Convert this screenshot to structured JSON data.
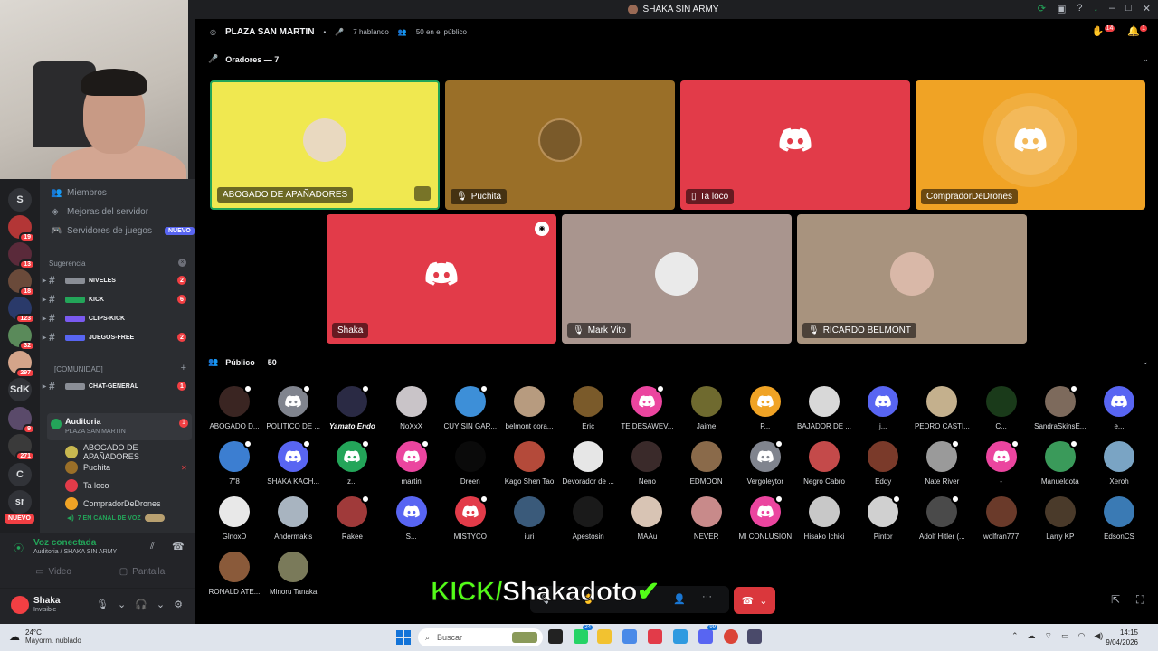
{
  "window": {
    "title": "SHAKA SIN ARMY"
  },
  "stage": {
    "channel": "PLAZA SAN MARTIN",
    "speaking": "7 hablando",
    "audience_count": "50 en el público",
    "hand_count": "14",
    "notif_count": "1",
    "speakers_header": "Oradores — 7",
    "audience_header": "Público — 50"
  },
  "speakers": [
    {
      "name": "ABOGADO DE APAÑADORES",
      "color": "#f0e850"
    },
    {
      "name": "Puchita",
      "color": "#9a6f28"
    },
    {
      "name": "Ta loco",
      "color": "#e23b49"
    },
    {
      "name": "CompradorDeDrones",
      "color": "#f0a325"
    },
    {
      "name": "Shaka",
      "color": "#e23b49"
    },
    {
      "name": "Mark Vito",
      "color": "#a9958e"
    },
    {
      "name": "RICARDO BELMONT",
      "color": "#a8937e"
    }
  ],
  "audience": [
    {
      "name": "ABOGADO D...",
      "color": "#3a2522",
      "icon": ""
    },
    {
      "name": "POLITICO DE ...",
      "color": "#80848e",
      "icon": "discord-icon"
    },
    {
      "name": "Yamato Endo",
      "color": "#2a2a44",
      "icon": ""
    },
    {
      "name": "NoXxX",
      "color": "#c9c4c8",
      "icon": ""
    },
    {
      "name": "CUY SIN GAR...",
      "color": "#3d8fd8",
      "icon": ""
    },
    {
      "name": "belmont cora...",
      "color": "#b79b7f",
      "icon": ""
    },
    {
      "name": "Eric",
      "color": "#7a5a2a",
      "icon": ""
    },
    {
      "name": "TE DESAWEV...",
      "color": "#eb459f",
      "icon": "discord-icon"
    },
    {
      "name": "Jaime",
      "color": "#6f6a2f",
      "icon": ""
    },
    {
      "name": "P...",
      "color": "#f0a325",
      "icon": "discord-icon"
    },
    {
      "name": "BAJADOR DE ...",
      "color": "#d8d8d8",
      "icon": ""
    },
    {
      "name": "j...",
      "color": "#5865f2",
      "icon": "discord-icon"
    },
    {
      "name": "PEDRO CASTI...",
      "color": "#c4b08d",
      "icon": ""
    },
    {
      "name": "C...",
      "color": "#1a3a1a",
      "icon": ""
    },
    {
      "name": "SandraSkinsE...",
      "color": "#7d6a5c",
      "icon": ""
    },
    {
      "name": "e...",
      "color": "#5865f2",
      "icon": "discord-icon"
    },
    {
      "name": "7\"8",
      "color": "#3c7ed1",
      "icon": ""
    },
    {
      "name": "SHAKA KACH...",
      "color": "#5865f2",
      "icon": "discord-icon"
    },
    {
      "name": "z...",
      "color": "#23a559",
      "icon": "discord-icon"
    },
    {
      "name": "martin",
      "color": "#eb459f",
      "icon": "discord-icon"
    },
    {
      "name": "Dreen",
      "color": "#0a0a0a",
      "icon": ""
    },
    {
      "name": "Kago Shen Tao",
      "color": "#b44a3a",
      "icon": ""
    },
    {
      "name": "Devorador de ...",
      "color": "#e6e6e6",
      "icon": ""
    },
    {
      "name": "Neno",
      "color": "#3a2a2a",
      "icon": ""
    },
    {
      "name": "EDMOON",
      "color": "#8a6a4a",
      "icon": ""
    },
    {
      "name": "Vergoleytor",
      "color": "#80848e",
      "icon": "discord-icon"
    },
    {
      "name": "Negro Cabro",
      "color": "#c44a4a",
      "icon": ""
    },
    {
      "name": "Eddy",
      "color": "#7a3a2a",
      "icon": ""
    },
    {
      "name": "Nate River",
      "color": "#9a9a9a",
      "icon": ""
    },
    {
      "name": "-",
      "color": "#eb459f",
      "icon": "discord-icon"
    },
    {
      "name": "Manueldota",
      "color": "#3a9a5a",
      "icon": ""
    },
    {
      "name": "Xeroh",
      "color": "#7aa4c4",
      "icon": ""
    },
    {
      "name": "GlnoxD",
      "color": "#e8e8e8",
      "icon": ""
    },
    {
      "name": "Andermakis",
      "color": "#a8b4c0",
      "icon": ""
    },
    {
      "name": "Rakee",
      "color": "#a03a3a",
      "icon": ""
    },
    {
      "name": "S...",
      "color": "#5865f2",
      "icon": "discord-icon"
    },
    {
      "name": "MISTYCO",
      "color": "#e23b49",
      "icon": "discord-icon"
    },
    {
      "name": "iuri",
      "color": "#3a5a7a",
      "icon": ""
    },
    {
      "name": "Apestosin",
      "color": "#1a1a1a",
      "icon": ""
    },
    {
      "name": "MAAu",
      "color": "#d8c4b4",
      "icon": ""
    },
    {
      "name": "NEVER",
      "color": "#c88a8a",
      "icon": ""
    },
    {
      "name": "MI CONLUSION",
      "color": "#eb459f",
      "icon": "discord-icon"
    },
    {
      "name": "Hisako Ichiki",
      "color": "#c8c8c8",
      "icon": ""
    },
    {
      "name": "Pintor",
      "color": "#d0d0d0",
      "icon": ""
    },
    {
      "name": "Adolf Hitler (...",
      "color": "#4a4a4a",
      "icon": ""
    },
    {
      "name": "wolfran777",
      "color": "#6a3a2a",
      "icon": ""
    },
    {
      "name": "Larry KP",
      "color": "#4a3a2a",
      "icon": ""
    },
    {
      "name": "EdsonCS",
      "color": "#3a7ab4",
      "icon": ""
    },
    {
      "name": "RONALD ATE...",
      "color": "#8a5a3a",
      "icon": ""
    },
    {
      "name": "Minoru Tanaka",
      "color": "#7a7a5a",
      "icon": ""
    }
  ],
  "sidebar": {
    "members": "Miembros",
    "boosts": "Mejoras del servidor",
    "game_servers": "Servidores de juegos",
    "new_tag": "NUEVO",
    "suggestion_header": "Sugerencia",
    "channels": [
      {
        "name": "NIVELES",
        "count": "2"
      },
      {
        "name": "KICK",
        "count": "6"
      },
      {
        "name": "CLIPS-KICK",
        "count": ""
      },
      {
        "name": "JUEGOS-FREE",
        "count": "2"
      }
    ],
    "community_header": "[COMUNIDAD]",
    "general": {
      "name": "CHAT-GENERAL",
      "count": "1"
    },
    "voice_channel": {
      "name": "Auditoria",
      "sub": "PLAZA SAN MARTIN",
      "count": "1"
    },
    "voice_members": [
      "ABOGADO DE APAÑADORES",
      "Puchita",
      "Ta loco",
      "CompradorDeDrones"
    ],
    "live_text": "7 EN CANAL DE VOZ"
  },
  "servers": [
    {
      "label": "S",
      "badge": ""
    },
    {
      "label": "",
      "badge": "19"
    },
    {
      "label": "",
      "badge": "13"
    },
    {
      "label": "",
      "badge": "18"
    },
    {
      "label": "",
      "badge": "123"
    },
    {
      "label": "",
      "badge": "32"
    },
    {
      "label": "",
      "badge": "297"
    },
    {
      "label": "SdK",
      "badge": ""
    },
    {
      "label": "",
      "badge": "9"
    },
    {
      "label": "",
      "badge": "271"
    },
    {
      "label": "C",
      "badge": ""
    },
    {
      "label": "sr",
      "badge": ""
    }
  ],
  "server_new": "NUEVO",
  "voice_panel": {
    "status": "Voz conectada",
    "sub": "Auditoria / SHAKA SIN ARMY",
    "video": "Video",
    "screen": "Pantalla"
  },
  "user": {
    "name": "Shaka",
    "status": "Invisible"
  },
  "overlay": {
    "kick": "KICK/",
    "name": "Shakadoto"
  },
  "taskbar": {
    "temp": "24°C",
    "weather": "Mayorm. nublado",
    "search": "Buscar",
    "time": "14:15",
    "date": "9/04/2026",
    "whatsapp_badge": "24",
    "discord_badge": "99"
  }
}
